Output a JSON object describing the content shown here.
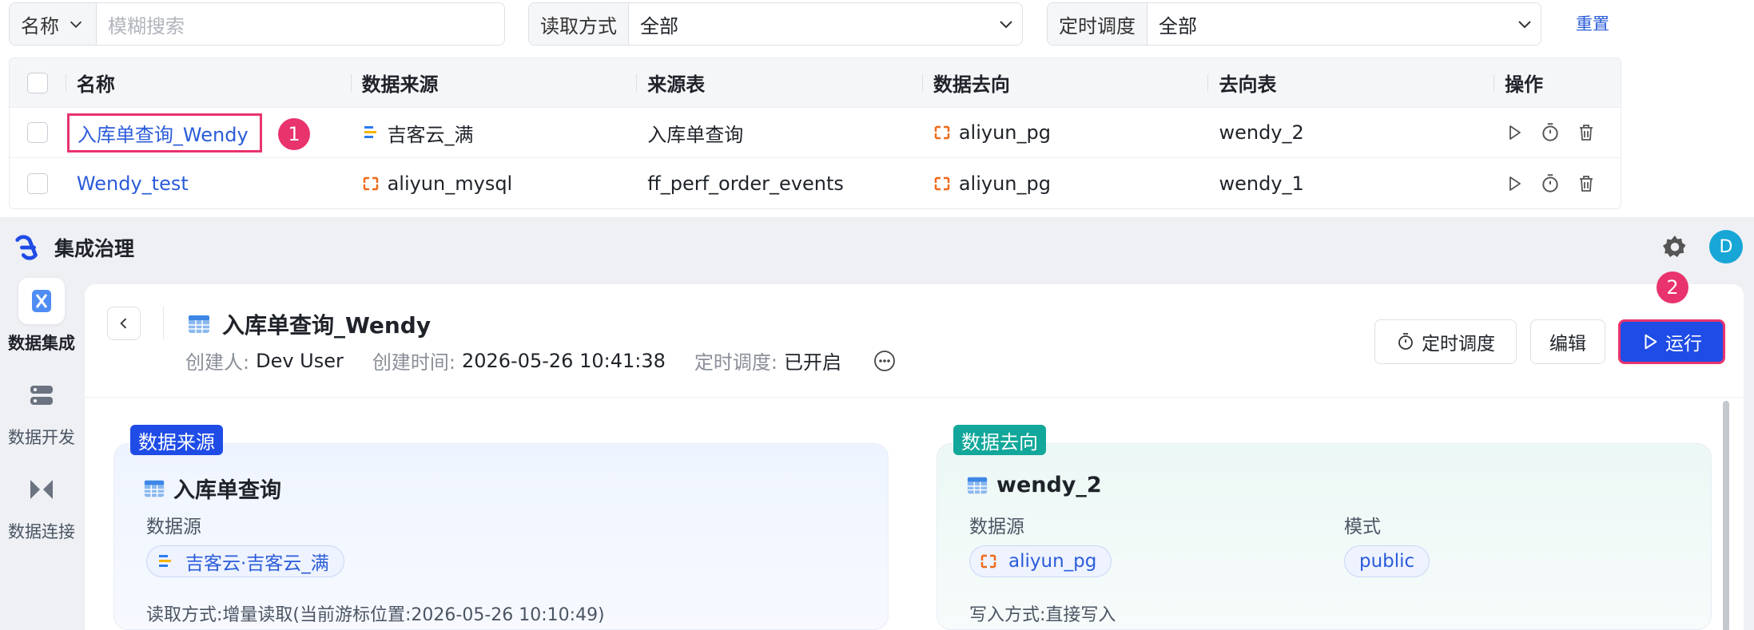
{
  "filters": {
    "name": {
      "label": "名称",
      "placeholder": "模糊搜索"
    },
    "read_mode": {
      "label": "读取方式",
      "value": "全部"
    },
    "schedule": {
      "label": "定时调度",
      "value": "全部"
    },
    "reset_label": "重置"
  },
  "table": {
    "columns": [
      "名称",
      "数据来源",
      "来源表",
      "数据去向",
      "去向表",
      "操作"
    ],
    "rows": [
      {
        "name": "入库单查询_Wendy",
        "source": "吉客云_满",
        "source_table": "入库单查询",
        "target": "aliyun_pg",
        "target_table": "wendy_2"
      },
      {
        "name": "Wendy_test",
        "source": "aliyun_mysql",
        "source_table": "ff_perf_order_events",
        "target": "aliyun_pg",
        "target_table": "wendy_1"
      }
    ]
  },
  "annotations": {
    "badge1": "1",
    "badge2": "2"
  },
  "app": {
    "title": "集成治理",
    "avatar": "D",
    "nav": [
      {
        "label": "数据集成",
        "icon": "data-integration-icon",
        "active": true
      },
      {
        "label": "数据开发",
        "icon": "data-dev-icon",
        "active": false
      },
      {
        "label": "数据连接",
        "icon": "data-connect-icon",
        "active": false
      }
    ]
  },
  "detail": {
    "title": "入库单查询_Wendy",
    "creator_label": "创建人:",
    "creator": "Dev User",
    "created_label": "创建时间:",
    "created": "2026-05-26 10:41:38",
    "schedule_label": "定时调度:",
    "schedule": "已开启",
    "buttons": {
      "schedule": "定时调度",
      "edit": "编辑",
      "run": "运行"
    }
  },
  "source_card": {
    "tag": "数据来源",
    "title": "入库单查询",
    "datasource_label": "数据源",
    "datasource": "吉客云·吉客云_满",
    "cut_text": "读取方式:增量读取(当前游标位置:2026-05-26 10:10:49)"
  },
  "target_card": {
    "tag": "数据去向",
    "title": "wendy_2",
    "datasource_label": "数据源",
    "datasource": "aliyun_pg",
    "schema_label": "模式",
    "schema": "public",
    "cut_text": "写入方式:直接写入"
  },
  "colors": {
    "accent": "#1f4ce6",
    "link": "#2b5cd9",
    "highlight": "#e8336d",
    "teal": "#12a79a"
  }
}
